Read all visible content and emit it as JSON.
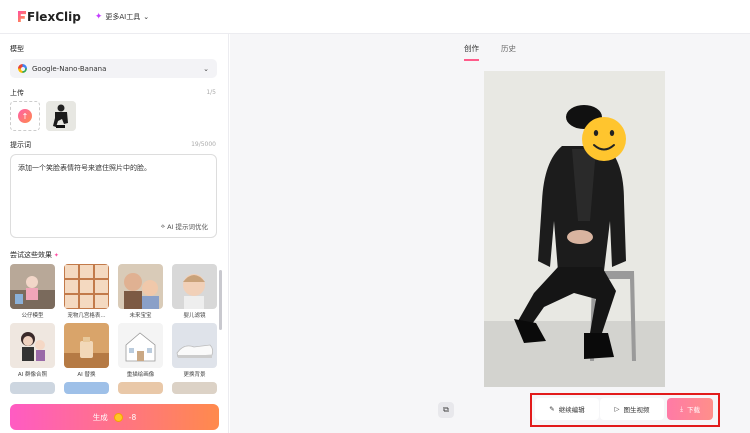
{
  "header": {
    "logo_text": "FlexClip",
    "ai_tools_label": "更多AI工具"
  },
  "left_panel": {
    "model_label": "模型",
    "model_value": "Google-Nano-Banana",
    "upload_label": "上传",
    "upload_count": "1/5",
    "prompt_label": "提示词",
    "prompt_count": "19/5000",
    "prompt_text": "添加一个笑脸表情符号来遮住照片中的脸。",
    "optimize_label": "AI 提示词优化",
    "effects_label": "尝试这些效果",
    "effects": [
      {
        "label": "公仔模型"
      },
      {
        "label": "宠物几宫格表..."
      },
      {
        "label": "未来宝宝"
      },
      {
        "label": "婴儿滤镜"
      },
      {
        "label": "AI 群像合照"
      },
      {
        "label": "AI 替换"
      },
      {
        "label": "重描绘画像"
      },
      {
        "label": "更换背景"
      }
    ],
    "generate_label": "生成",
    "generate_cost": "-8"
  },
  "right_panel": {
    "tabs": [
      {
        "label": "创作",
        "active": true
      },
      {
        "label": "历史",
        "active": false
      }
    ],
    "actions": {
      "edit_label": "继续编辑",
      "video_label": "图生视频",
      "download_label": "下载"
    }
  },
  "colors": {
    "accent_gradient_start": "#ff5bc3",
    "accent_gradient_end": "#ff8a4c",
    "highlight_red": "#e21b1b"
  }
}
